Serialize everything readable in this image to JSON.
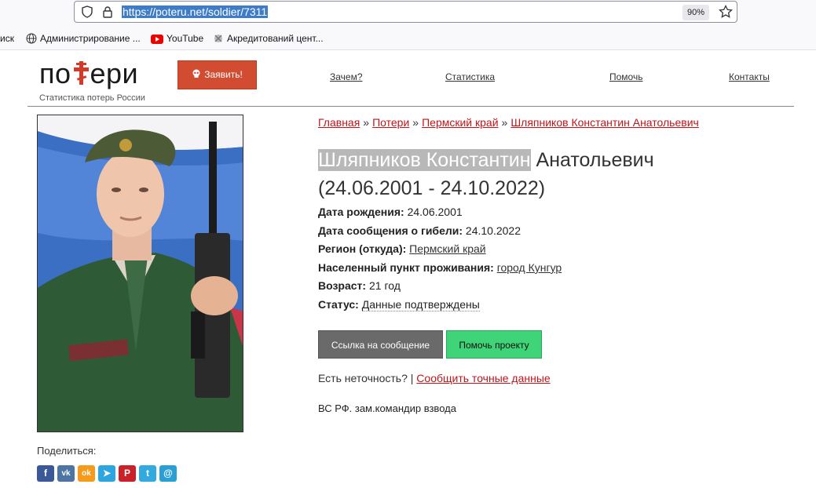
{
  "browser": {
    "url": "https://poteru.net/soldier/7311",
    "zoom": "90%",
    "bookmarks": [
      {
        "label": "иск"
      },
      {
        "label": "Администрирование ..."
      },
      {
        "label": "YouTube"
      },
      {
        "label": "Акредитований цент..."
      }
    ]
  },
  "site": {
    "logo_left": "по",
    "logo_right": "ери",
    "logo_subtitle": "Статистика потерь России",
    "report_button": "Заявить!",
    "nav": [
      "Зачем?",
      "Статистика",
      "Помочь",
      "Контакты"
    ]
  },
  "breadcrumbs": [
    "Главная",
    "Потери",
    "Пермский край",
    "Шляпников Константин Анатольевич"
  ],
  "breadcrumb_separator": "»",
  "person": {
    "name_highlighted": "Шляпников Константин",
    "name_rest": " Анатольевич",
    "dates": "(24.06.2001 - 24.10.2022)",
    "facts": {
      "birth_label": "Дата рождения:",
      "birth_value": "24.06.2001",
      "death_label": "Дата сообщения о гибели:",
      "death_value": "24.10.2022",
      "region_label": "Регион (откуда):",
      "region_value": "Пермский край",
      "city_label": "Населенный пункт проживания:",
      "city_value": "город Кунгур",
      "age_label": "Возраст:",
      "age_value": "21 год",
      "status_label": "Статус:",
      "status_value": "Данные подтверждены"
    }
  },
  "actions": {
    "link_button": "Ссылка на сообщение",
    "help_button": "Помочь проекту",
    "inaccuracy_text": "Есть неточность? | ",
    "inaccuracy_link": "Сообщить точные данные"
  },
  "note": "ВС РФ. зам.командир взвода",
  "share": {
    "label": "Поделиться:",
    "icons": [
      {
        "name": "facebook",
        "glyph": "f",
        "color": "#3b5998"
      },
      {
        "name": "vk",
        "glyph": "vk",
        "color": "#4c75a3"
      },
      {
        "name": "odnoklassniki",
        "glyph": "ok",
        "color": "#f59a1a"
      },
      {
        "name": "telegram",
        "glyph": "➤",
        "color": "#2ca5e0"
      },
      {
        "name": "pinterest",
        "glyph": "P",
        "color": "#cb2027"
      },
      {
        "name": "twitter",
        "glyph": "t",
        "color": "#33a9e1"
      },
      {
        "name": "email",
        "glyph": "@",
        "color": "#2a9fd6"
      }
    ]
  }
}
